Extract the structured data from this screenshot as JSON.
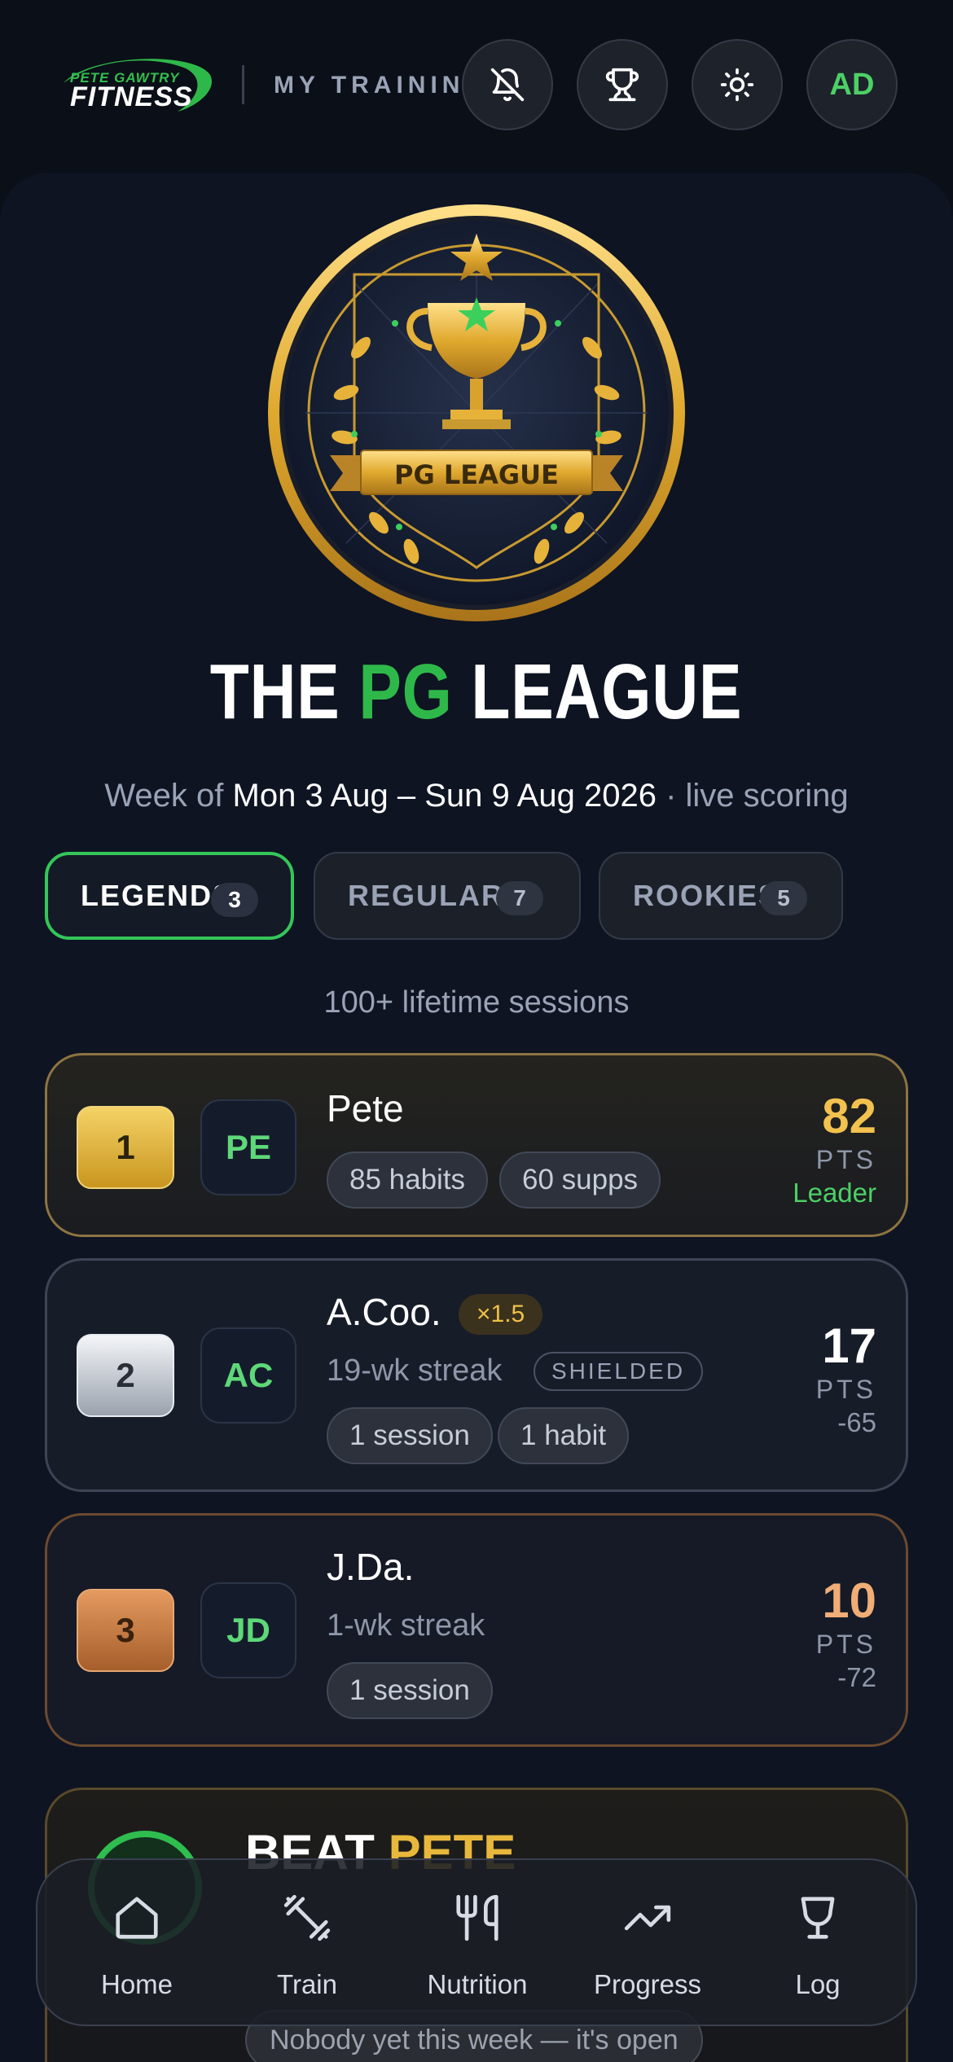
{
  "header": {
    "logo_top": "PETE GAWTRY",
    "logo_main": "FITNESS",
    "title": "MY TRAINING",
    "buttons": [
      {
        "icon": "bell-off-icon"
      },
      {
        "icon": "trophy-icon"
      },
      {
        "icon": "sun-icon"
      }
    ],
    "avatar_initials": "AD"
  },
  "badge": {
    "banner_text": "PG LEAGUE"
  },
  "league": {
    "title_pre": "THE",
    "title_accent": "PG",
    "title_post": "LEAGUE",
    "week_prefix": "Week of",
    "week_range": "Mon 3 Aug – Sun 9 Aug 2026",
    "week_suffix": "· live scoring"
  },
  "tabs": [
    {
      "label": "LEGENDS",
      "count": "3",
      "active": true
    },
    {
      "label": "REGULARS",
      "count": "7",
      "active": false
    },
    {
      "label": "ROOKIES",
      "count": "5",
      "active": false
    }
  ],
  "tier_description": "100+ lifetime sessions",
  "leaderboard": [
    {
      "rank": "1",
      "initials": "PE",
      "name": "Pete",
      "chips": [
        "85 habits",
        "60 supps"
      ],
      "points": "82",
      "points_label": "PTS",
      "sub": "Leader",
      "color": "#f2c14e"
    },
    {
      "rank": "2",
      "initials": "AC",
      "name": "A.Coo.",
      "multiplier": "×1.5",
      "streak": "19-wk streak",
      "shield": "SHIELDED",
      "chips": [
        "1 session",
        "1 habit"
      ],
      "points": "17",
      "points_label": "PTS",
      "sub": "-65",
      "color": "#ffffff"
    },
    {
      "rank": "3",
      "initials": "JD",
      "name": "J.Da.",
      "streak": "1-wk streak",
      "chips": [
        "1 session"
      ],
      "points": "10",
      "points_label": "PTS",
      "sub": "-72",
      "color": "#f0ad76"
    }
  ],
  "beat_card": {
    "title_pre": "BEAT",
    "title_accent": "PETE",
    "pill": "Nobody yet this week — it's open"
  },
  "bottom_nav": [
    {
      "label": "Home",
      "icon": "home-icon"
    },
    {
      "label": "Train",
      "icon": "dumbbell-icon"
    },
    {
      "label": "Nutrition",
      "icon": "utensils-icon"
    },
    {
      "label": "Progress",
      "icon": "trend-up-icon"
    },
    {
      "label": "Log",
      "icon": "goblet-icon"
    }
  ],
  "colors": {
    "accent": "#2fb84a",
    "gold": "#f2c14e",
    "background": "#0b0f18"
  }
}
